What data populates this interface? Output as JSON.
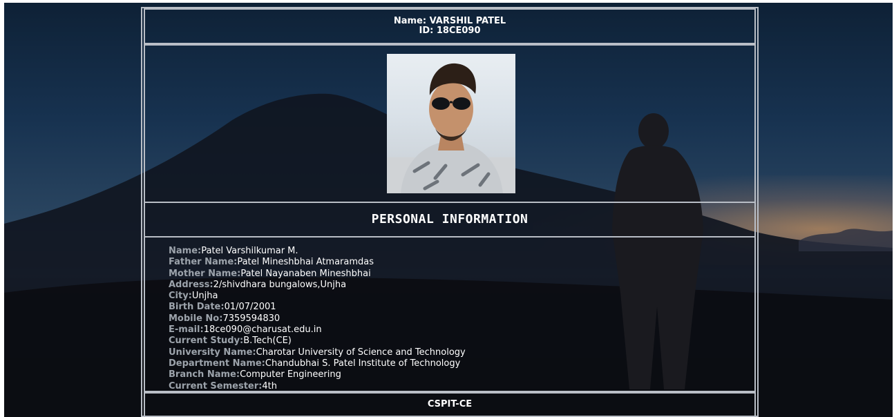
{
  "header": {
    "name_line": "Name: VARSHIL PATEL",
    "id_line": "ID: 18CE090"
  },
  "section_title": "PERSONAL INFORMATION",
  "info": [
    {
      "label": "Name:",
      "value": "Patel Varshilkumar M."
    },
    {
      "label": "Father Name:",
      "value": "Patel Mineshbhai Atmaramdas"
    },
    {
      "label": "Mother Name:",
      "value": "Patel Nayanaben Mineshbhai"
    },
    {
      "label": "Address:",
      "value": "2/shivdhara bungalows,Unjha"
    },
    {
      "label": "City:",
      "value": "Unjha"
    },
    {
      "label": "Birth Date:",
      "value": "01/07/2001"
    },
    {
      "label": "Mobile No:",
      "value": "7359594830"
    },
    {
      "label": "E-mail:",
      "value": "18ce090@charusat.edu.in"
    },
    {
      "label": "Current Study:",
      "value": "B.Tech(CE)"
    },
    {
      "label": "University Name:",
      "value": "Charotar University of Science and Technology"
    },
    {
      "label": "Department Name:",
      "value": "Chandubhai S. Patel Institute of Technology"
    },
    {
      "label": "Branch Name:",
      "value": "Computer Engineering"
    },
    {
      "label": "Current Semester:",
      "value": "4th"
    }
  ],
  "footer": "CSPIT-CE",
  "colors": {
    "label": "#9ca3ab",
    "value": "#ffffff",
    "border": "#b9bec6"
  }
}
